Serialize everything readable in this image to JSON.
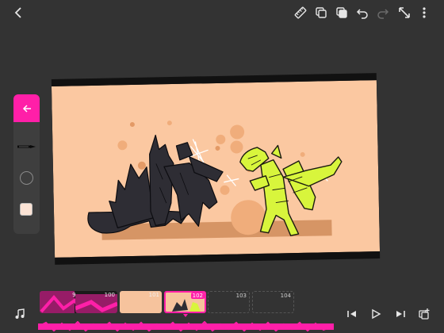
{
  "colors": {
    "background": "#333333",
    "accent": "#ff1fa8",
    "canvas_bg": "#fbc8a1",
    "toolbar_icon": "#e6e6e6"
  },
  "toolbar": {
    "icons": [
      "back-arrow-icon",
      "ruler-icon",
      "duplicate-icon",
      "layers-copy-icon",
      "undo-icon",
      "redo-icon",
      "expand-icon",
      "more-vertical-icon"
    ]
  },
  "tool_panel": {
    "icons": [
      "arrow-left-icon",
      "pencil-brush-icon",
      "brush-size-icon",
      "color-swatch-icon"
    ],
    "selected_color": "#fbe3d5"
  },
  "timeline": {
    "frames": [
      {
        "number": "99",
        "state": "filled"
      },
      {
        "number": "100",
        "state": "filled"
      },
      {
        "number": "101",
        "state": "filled"
      },
      {
        "number": "102",
        "state": "active"
      },
      {
        "number": "103",
        "state": "empty"
      },
      {
        "number": "104",
        "state": "empty"
      }
    ]
  },
  "playback": {
    "icons": [
      "music-note-icon",
      "skip-to-start-icon",
      "play-icon",
      "skip-to-end-icon",
      "add-frame-icon"
    ]
  }
}
